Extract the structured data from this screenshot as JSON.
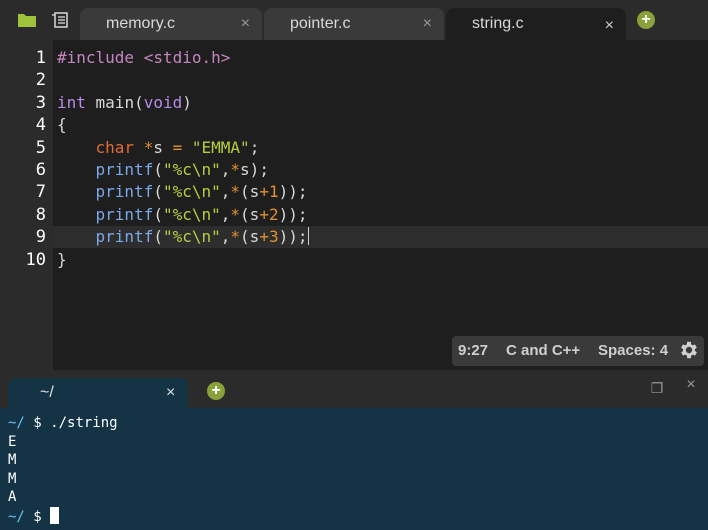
{
  "tabs": [
    {
      "label": "memory.c",
      "active": false
    },
    {
      "label": "pointer.c",
      "active": false
    },
    {
      "label": "string.c",
      "active": true
    }
  ],
  "tab_close_glyph": "×",
  "add_glyph": "+",
  "editor": {
    "line_numbers": [
      "1",
      "2",
      "3",
      "4",
      "5",
      "6",
      "7",
      "8",
      "9",
      "10"
    ],
    "active_line": 9,
    "lines": [
      [
        {
          "c": "pre",
          "t": "#include <stdio.h>"
        }
      ],
      [],
      [
        {
          "c": "kw",
          "t": "int"
        },
        {
          "c": "plain",
          "t": " main"
        },
        {
          "c": "plain",
          "t": "("
        },
        {
          "c": "kw",
          "t": "void"
        },
        {
          "c": "plain",
          "t": ")"
        }
      ],
      [
        {
          "c": "plain",
          "t": "{"
        }
      ],
      [
        {
          "c": "plain",
          "t": "    "
        },
        {
          "c": "type",
          "t": "char"
        },
        {
          "c": "plain",
          "t": " "
        },
        {
          "c": "op",
          "t": "*"
        },
        {
          "c": "plain",
          "t": "s "
        },
        {
          "c": "op",
          "t": "="
        },
        {
          "c": "plain",
          "t": " "
        },
        {
          "c": "str",
          "t": "\"EMMA\""
        },
        {
          "c": "plain",
          "t": ";"
        }
      ],
      [
        {
          "c": "plain",
          "t": "    "
        },
        {
          "c": "fn",
          "t": "printf"
        },
        {
          "c": "plain",
          "t": "("
        },
        {
          "c": "str",
          "t": "\"%c\\n\""
        },
        {
          "c": "plain",
          "t": ","
        },
        {
          "c": "op",
          "t": "*"
        },
        {
          "c": "plain",
          "t": "s);"
        }
      ],
      [
        {
          "c": "plain",
          "t": "    "
        },
        {
          "c": "fn",
          "t": "printf"
        },
        {
          "c": "plain",
          "t": "("
        },
        {
          "c": "str",
          "t": "\"%c\\n\""
        },
        {
          "c": "plain",
          "t": ","
        },
        {
          "c": "op",
          "t": "*"
        },
        {
          "c": "plain",
          "t": "(s"
        },
        {
          "c": "op",
          "t": "+"
        },
        {
          "c": "num",
          "t": "1"
        },
        {
          "c": "plain",
          "t": "));"
        }
      ],
      [
        {
          "c": "plain",
          "t": "    "
        },
        {
          "c": "fn",
          "t": "printf"
        },
        {
          "c": "plain",
          "t": "("
        },
        {
          "c": "str",
          "t": "\"%c\\n\""
        },
        {
          "c": "plain",
          "t": ","
        },
        {
          "c": "op",
          "t": "*"
        },
        {
          "c": "plain",
          "t": "(s"
        },
        {
          "c": "op",
          "t": "+"
        },
        {
          "c": "num",
          "t": "2"
        },
        {
          "c": "plain",
          "t": "));"
        }
      ],
      [
        {
          "c": "plain",
          "t": "    "
        },
        {
          "c": "fn",
          "t": "printf"
        },
        {
          "c": "plain",
          "t": "("
        },
        {
          "c": "str",
          "t": "\"%c\\n\""
        },
        {
          "c": "plain",
          "t": ","
        },
        {
          "c": "op",
          "t": "*"
        },
        {
          "c": "plain",
          "t": "(s"
        },
        {
          "c": "op",
          "t": "+"
        },
        {
          "c": "num",
          "t": "3"
        },
        {
          "c": "plain",
          "t": "));"
        }
      ],
      [
        {
          "c": "plain",
          "t": "}"
        }
      ]
    ]
  },
  "status": {
    "cursor_pos": "9:27",
    "language": "C and C++",
    "indent": "Spaces: 4"
  },
  "terminal": {
    "tab_label": "~/",
    "lines": [
      {
        "prompt": "~/",
        "sign": " $ ",
        "text": "./string"
      },
      {
        "text": "E"
      },
      {
        "text": "M"
      },
      {
        "text": "M"
      },
      {
        "text": "A"
      }
    ],
    "final_prompt": {
      "prompt": "~/",
      "sign": " $ "
    }
  },
  "window_controls": {
    "restore_glyph": "❐",
    "close_glyph": "×"
  },
  "colors": {
    "accent_green": "#8aa03a",
    "terminal_bg": "#143446",
    "editor_bg": "#1e1e1e"
  }
}
